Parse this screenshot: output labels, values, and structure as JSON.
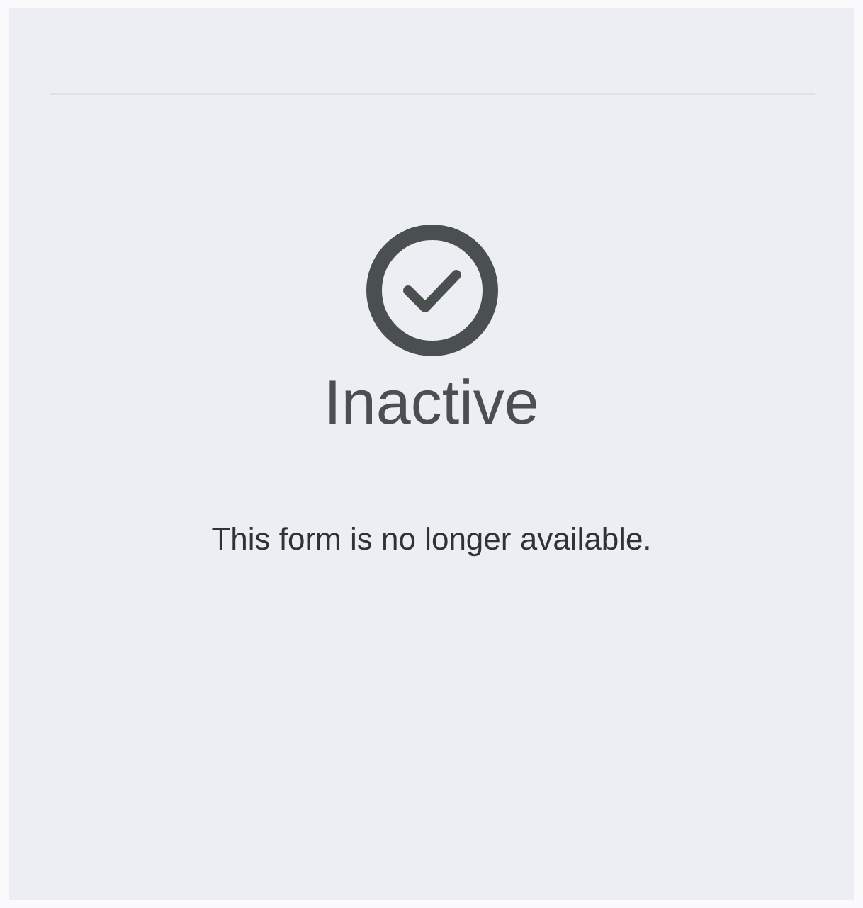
{
  "status": {
    "title": "Inactive",
    "message": "This form is no longer available."
  }
}
